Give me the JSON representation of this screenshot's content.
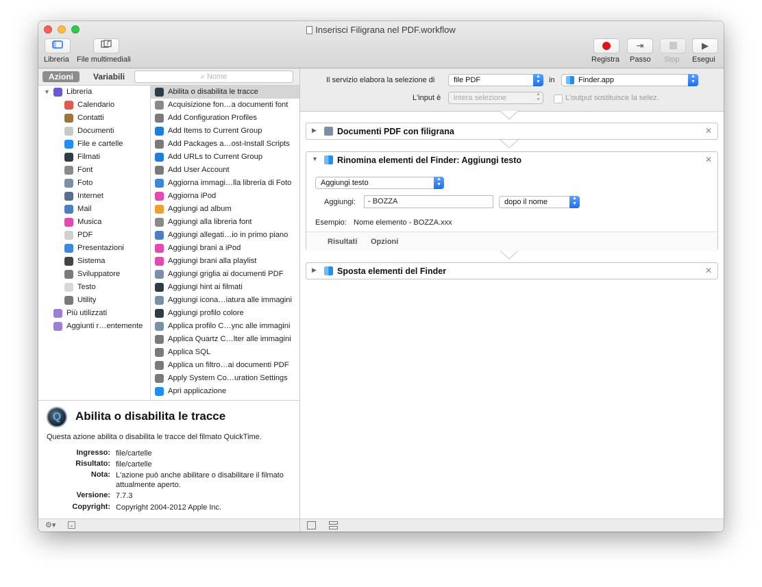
{
  "window": {
    "title": "Inserisci Filigrana nel PDF.workflow"
  },
  "toolbar": {
    "library_label": "Libreria",
    "media_label": "File multimediali",
    "record_label": "Registra",
    "step_label": "Passo",
    "stop_label": "Stop",
    "run_label": "Esegui"
  },
  "left": {
    "tab_actions": "Azioni",
    "tab_variables": "Variabili",
    "search_placeholder": "Nome",
    "library": [
      {
        "label": "Libreria",
        "icon": "library-icon",
        "color": "#6a5acd"
      },
      {
        "label": "Calendario",
        "icon": "calendar-icon",
        "color": "#e05a4f"
      },
      {
        "label": "Contatti",
        "icon": "contacts-icon",
        "color": "#a0743d"
      },
      {
        "label": "Documenti",
        "icon": "document-icon",
        "color": "#c9c9c9"
      },
      {
        "label": "File e cartelle",
        "icon": "finder-icon",
        "color": "#1f8ef1"
      },
      {
        "label": "Filmati",
        "icon": "quicktime-icon",
        "color": "#2f3b48"
      },
      {
        "label": "Font",
        "icon": "font-icon",
        "color": "#8a8a8a"
      },
      {
        "label": "Foto",
        "icon": "photo-icon",
        "color": "#7b8fa6"
      },
      {
        "label": "Internet",
        "icon": "globe-icon",
        "color": "#5a6f8a"
      },
      {
        "label": "Mail",
        "icon": "mail-icon",
        "color": "#4a7fc1"
      },
      {
        "label": "Musica",
        "icon": "music-icon",
        "color": "#e24ab0"
      },
      {
        "label": "PDF",
        "icon": "pdf-icon",
        "color": "#d0d0d0"
      },
      {
        "label": "Presentazioni",
        "icon": "presentation-icon",
        "color": "#3c89d9"
      },
      {
        "label": "Sistema",
        "icon": "system-icon",
        "color": "#444444"
      },
      {
        "label": "Sviluppatore",
        "icon": "developer-icon",
        "color": "#7a7a7a"
      },
      {
        "label": "Testo",
        "icon": "text-icon",
        "color": "#d8d8d8"
      },
      {
        "label": "Utility",
        "icon": "utility-icon",
        "color": "#7a7a7a"
      },
      {
        "label": "Più utilizzati",
        "icon": "smart-folder-icon",
        "color": "#9b7fd4"
      },
      {
        "label": "Aggiunti r…entemente",
        "icon": "smart-folder-icon",
        "color": "#9b7fd4"
      }
    ],
    "actions": [
      {
        "label": "Abilita o disabilita le tracce",
        "icon": "quicktime-icon",
        "color": "#2f3b48"
      },
      {
        "label": "Acquisizione fon…a documenti font",
        "icon": "font-icon",
        "color": "#8a8a8a"
      },
      {
        "label": "Add Configuration Profiles",
        "icon": "installer-icon",
        "color": "#7a7a7a"
      },
      {
        "label": "Add Items to Current Group",
        "icon": "xcode-server-icon",
        "color": "#1e7fd8"
      },
      {
        "label": "Add Packages a…ost-Install Scripts",
        "icon": "installer-icon",
        "color": "#7a7a7a"
      },
      {
        "label": "Add URLs to Current Group",
        "icon": "xcode-server-icon",
        "color": "#1e7fd8"
      },
      {
        "label": "Add User Account",
        "icon": "installer-icon",
        "color": "#7a7a7a"
      },
      {
        "label": "Aggiorna immagi…lla libreria di Foto",
        "icon": "keynote-icon",
        "color": "#3c89d9"
      },
      {
        "label": "Aggiorna iPod",
        "icon": "music-icon",
        "color": "#e24ab0"
      },
      {
        "label": "Aggiungi ad album",
        "icon": "photos-icon",
        "color": "#f0a030"
      },
      {
        "label": "Aggiungi alla libreria font",
        "icon": "font-icon",
        "color": "#8a8a8a"
      },
      {
        "label": "Aggiungi allegati…io in primo piano",
        "icon": "mail-icon",
        "color": "#4a7fc1"
      },
      {
        "label": "Aggiungi brani a iPod",
        "icon": "music-icon",
        "color": "#e24ab0"
      },
      {
        "label": "Aggiungi brani alla playlist",
        "icon": "music-icon",
        "color": "#e24ab0"
      },
      {
        "label": "Aggiungi griglia ai documenti PDF",
        "icon": "preview-icon",
        "color": "#7b8fa6"
      },
      {
        "label": "Aggiungi hint ai filmati",
        "icon": "quicktime-icon",
        "color": "#2f3b48"
      },
      {
        "label": "Aggiungi icona…iatura alle immagini",
        "icon": "preview-icon",
        "color": "#7b8fa6"
      },
      {
        "label": "Aggiungi profilo colore",
        "icon": "quicktime-icon",
        "color": "#2f3b48"
      },
      {
        "label": "Applica profilo C…ync alle immagini",
        "icon": "preview-icon",
        "color": "#7b8fa6"
      },
      {
        "label": "Applica Quartz C…lter alle immagini",
        "icon": "tools-icon",
        "color": "#7a7a7a"
      },
      {
        "label": "Applica SQL",
        "icon": "tools-icon",
        "color": "#7a7a7a"
      },
      {
        "label": "Applica un filtro…ai documenti PDF",
        "icon": "tools-icon",
        "color": "#7a7a7a"
      },
      {
        "label": "Apply System Co…uration Settings",
        "icon": "installer-icon",
        "color": "#7a7a7a"
      },
      {
        "label": "Apri applicazione",
        "icon": "finder-icon",
        "color": "#1f8ef1"
      }
    ],
    "description": {
      "title": "Abilita o disabilita le tracce",
      "text": "Questa azione abilita o disabilita le tracce del filmato QuickTime.",
      "fields": [
        {
          "key": "Ingresso:",
          "value": "file/cartelle"
        },
        {
          "key": "Risultato:",
          "value": "file/cartelle"
        },
        {
          "key": "Nota:",
          "value": "L'azione può anche abilitare o disabilitare il filmato attualmente aperto."
        },
        {
          "key": "Versione:",
          "value": "7.7.3"
        },
        {
          "key": "Copyright:",
          "value": "Copyright 2004-2012 Apple Inc."
        }
      ]
    }
  },
  "workflow": {
    "service_label": "Il servizio elabora la selezione di",
    "service_value": "file PDF",
    "in_label": "in",
    "app_value": "Finder.app",
    "input_label": "L'input è",
    "input_value": "intera selezione",
    "output_checkbox_label": "L'output sostituisce la selez.",
    "actions": [
      {
        "title": "Documenti PDF con filigrana"
      },
      {
        "title": "Rinomina elementi del Finder: Aggiungi testo",
        "mode_value": "Aggiungi testo",
        "add_label": "Aggiungi:",
        "add_value": "- BOZZA",
        "position_value": "dopo il nome",
        "example_label": "Esempio:",
        "example_value": "Nome elemento - BOZZA.xxx",
        "tab_results": "Risultati",
        "tab_options": "Opzioni"
      },
      {
        "title": "Sposta elementi del Finder"
      }
    ]
  }
}
